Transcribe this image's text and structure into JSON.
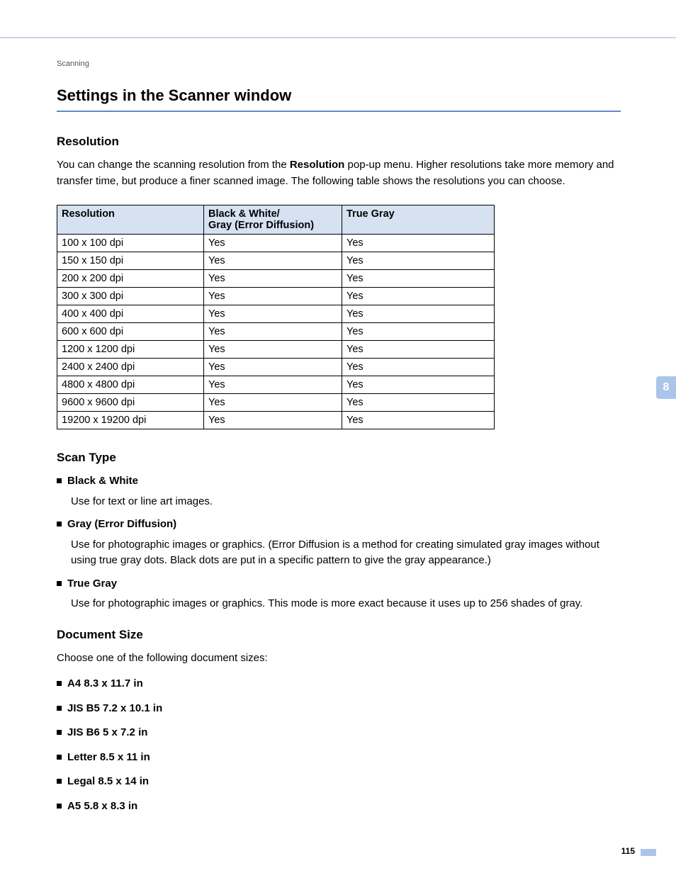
{
  "breadcrumb": "Scanning",
  "main_heading": "Settings in the Scanner window",
  "resolution": {
    "heading": "Resolution",
    "intro_pre": "You can change the scanning resolution from the ",
    "intro_bold": "Resolution",
    "intro_post": " pop-up menu. Higher resolutions take more memory and transfer time, but produce a finer scanned image. The following table shows the resolutions you can choose."
  },
  "table": {
    "headers": {
      "col1": "Resolution",
      "col2_line1": "Black & White/",
      "col2_line2": "Gray (Error Diffusion)",
      "col3": "True Gray"
    },
    "rows": [
      {
        "res": "100 x 100 dpi",
        "bw": "Yes",
        "tg": "Yes"
      },
      {
        "res": "150 x 150 dpi",
        "bw": "Yes",
        "tg": "Yes"
      },
      {
        "res": "200 x 200 dpi",
        "bw": "Yes",
        "tg": "Yes"
      },
      {
        "res": "300 x 300 dpi",
        "bw": "Yes",
        "tg": "Yes"
      },
      {
        "res": "400 x 400 dpi",
        "bw": "Yes",
        "tg": "Yes"
      },
      {
        "res": "600 x 600 dpi",
        "bw": "Yes",
        "tg": "Yes"
      },
      {
        "res": "1200 x 1200 dpi",
        "bw": "Yes",
        "tg": "Yes"
      },
      {
        "res": "2400 x 2400 dpi",
        "bw": "Yes",
        "tg": "Yes"
      },
      {
        "res": "4800 x 4800 dpi",
        "bw": "Yes",
        "tg": "Yes"
      },
      {
        "res": "9600 x 9600 dpi",
        "bw": "Yes",
        "tg": "Yes"
      },
      {
        "res": "19200 x 19200 dpi",
        "bw": "Yes",
        "tg": "Yes"
      }
    ]
  },
  "scan_type": {
    "heading": "Scan Type",
    "items": [
      {
        "label": "Black & White",
        "desc": "Use for text or line art images."
      },
      {
        "label": "Gray (Error Diffusion)",
        "desc": "Use for photographic images or graphics. (Error Diffusion is a method for creating simulated gray images without using true gray dots. Black dots are put in a specific pattern to give the gray appearance.)"
      },
      {
        "label": "True Gray",
        "desc": "Use for photographic images or graphics. This mode is more exact because it uses up to 256 shades of gray."
      }
    ]
  },
  "doc_size": {
    "heading": "Document Size",
    "intro": "Choose one of the following document sizes:",
    "items": [
      "A4 8.3 x 11.7 in",
      "JIS B5 7.2 x 10.1 in",
      "JIS B6 5 x 7.2 in",
      "Letter 8.5 x 11 in",
      "Legal 8.5 x 14 in",
      "A5 5.8 x 8.3 in"
    ]
  },
  "chapter_tab": "8",
  "page_number": "115"
}
